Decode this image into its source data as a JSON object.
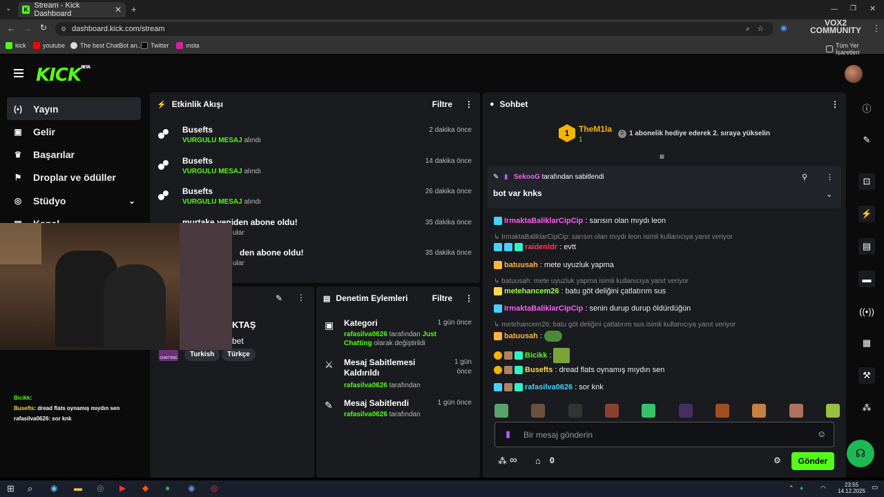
{
  "browser": {
    "tab_title": "Stream - Kick Dashboard",
    "url": "dashboard.kick.com/stream",
    "bookmarks": [
      "kick",
      "youtube",
      "The best ChatBot an...",
      "Twitter",
      "ınsta"
    ],
    "bookmarks_all": "Tüm Yer İşaretleri",
    "watermark": "VOX2 COMMUNITY"
  },
  "app": {
    "logo": "KICK",
    "logo_tag": "BETA"
  },
  "sidebar": {
    "items": [
      {
        "label": "Yayın",
        "icon": "broadcast-icon"
      },
      {
        "label": "Gelir",
        "icon": "revenue-icon"
      },
      {
        "label": "Başarılar",
        "icon": "trophy-icon"
      },
      {
        "label": "Droplar ve ödüller",
        "icon": "gift-icon"
      },
      {
        "label": "Stüdyo",
        "icon": "studio-icon"
      },
      {
        "label": "Kanal",
        "icon": "channel-icon"
      }
    ]
  },
  "activity": {
    "title": "Etkinlik Akışı",
    "filter": "Filtre",
    "events": [
      {
        "name": "Busefts",
        "highlight": "VURGULU MESAJ",
        "suffix": "alındı",
        "time": "2 dakika önce"
      },
      {
        "name": "Busefts",
        "highlight": "VURGULU MESAJ",
        "suffix": "alındı",
        "time": "14 dakika önce"
      },
      {
        "name": "Busefts",
        "highlight": "VURGULU MESAJ",
        "suffix": "alındı",
        "time": "26 dakika önce"
      },
      {
        "name": "murtake yeniden abone oldu!",
        "highlight": "",
        "suffix": "ular",
        "time": "35 dakika önce"
      },
      {
        "name": "den abone oldu!",
        "highlight": "",
        "suffix": "ular",
        "time": "35 dakika önce"
      }
    ]
  },
  "stream_info": {
    "title_fragment": "KTAŞ",
    "sub_fragment": "bet",
    "tags": [
      "Turkish",
      "Türkçe"
    ],
    "category_thumb": "CHATTING"
  },
  "moderation": {
    "title": "Denetim Eylemleri",
    "filter": "Filtre",
    "actions": [
      {
        "title": "Kategori",
        "user": "rafasilva0626",
        "desc1": "tarafından",
        "desc_highlight": "Just Chatting",
        "desc2": "olarak değiştirildi",
        "time": "1 gün önce"
      },
      {
        "title": "Mesaj Sabitlemesi Kaldırıldı",
        "user": "rafasilva0626",
        "desc1": "tarafından",
        "desc_highlight": "",
        "desc2": "",
        "time": "1 gün önce"
      },
      {
        "title": "Mesaj Sabitlendi",
        "user": "rafasilva0626",
        "desc1": "tarafından",
        "desc_highlight": "",
        "desc2": "",
        "time": "1 gün önce"
      }
    ]
  },
  "chat": {
    "title": "Sohbet",
    "top_gifter": {
      "name": "TheM1la",
      "rank": "1",
      "count": "1"
    },
    "gift_prompt": "1 abonelik hediye ederek 2. sıraya yükselin",
    "pinned": {
      "by": "SekooG",
      "by_suffix": "tarafından sabitlendi",
      "message": "bot var knks"
    },
    "messages": [
      {
        "type": "msg",
        "user": "IrmaktaBaliklarCipCip",
        "color": "#ff5cf4",
        "text": ": sarısın olan mıydı leon"
      },
      {
        "type": "reply",
        "text": "IrmaktaBaliklarCipCip: sarısın olan mıydı leon isimli kullanıcıya yanıt veriyor"
      },
      {
        "type": "msg",
        "user": "raidenldr",
        "color": "#ff3860",
        "text": ": evtt"
      },
      {
        "type": "msg",
        "user": "batuusah",
        "color": "#ffb347",
        "text": ": mete uyuzluk yapma"
      },
      {
        "type": "reply",
        "text": "batuusah: mete uyuzluk yapma isimli kullanıcıya yanıt veriyor"
      },
      {
        "type": "msg",
        "user": "metehancem26",
        "color": "#9cff47",
        "text": ": batu göt deliğini çatlatırım sus"
      },
      {
        "type": "msg",
        "user": "IrmaktaBaliklarCipCip",
        "color": "#ff5cf4",
        "text": ": senin durup durup öldürdüğün"
      },
      {
        "type": "reply",
        "text": "metehancem26: batu göt deliğini çatlatırım sus isimli kullanıcıya yanıt veriyor"
      },
      {
        "type": "msg",
        "user": "batuusah",
        "color": "#ffb347",
        "text": ":"
      },
      {
        "type": "msg",
        "user": "Bicikk",
        "color": "#53fc18",
        "text": ":"
      },
      {
        "type": "msg",
        "user": "Busefts",
        "color": "#ffd84d",
        "text": ": dread flats oynamış mıydın sen"
      },
      {
        "type": "msg",
        "user": "rafasilva0626",
        "color": "#47d1ff",
        "text": ": sor knk"
      }
    ],
    "input_placeholder": "Bir mesaj gönderin",
    "points_value": "∞",
    "drops_count": "0",
    "send_label": "Gönder"
  },
  "overlay_chat": [
    {
      "user": "Bicikk",
      "text": ":"
    },
    {
      "user": "Busefts",
      "text": ": dread flats oynamış mıydın sen"
    },
    {
      "user": "rafasilva0626",
      "text": ": sor knk"
    }
  ],
  "taskbar": {
    "time": "23:55",
    "date": "14.12.2025"
  }
}
